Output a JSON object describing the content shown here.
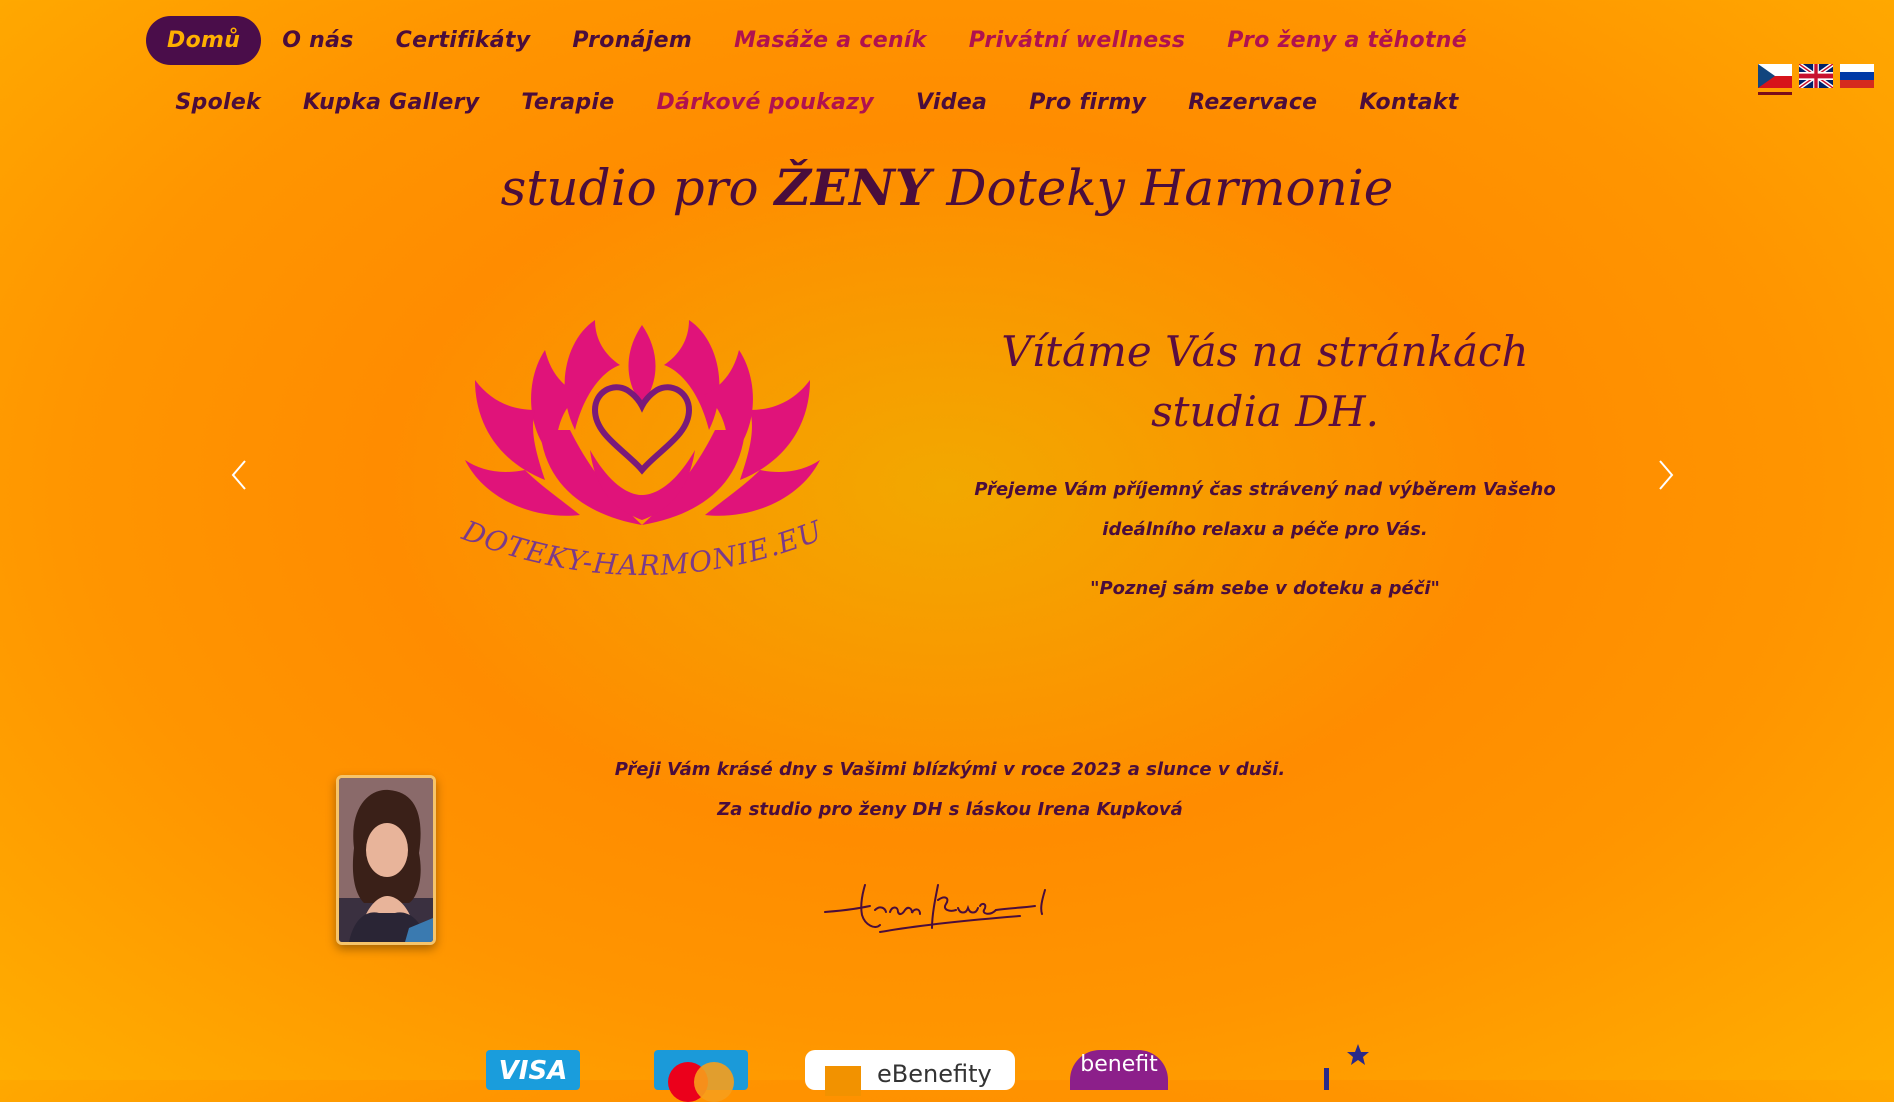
{
  "nav": {
    "row1": [
      {
        "label": "Domů",
        "active": true
      },
      {
        "label": "O nás"
      },
      {
        "label": "Certifikáty"
      },
      {
        "label": "Pronájem"
      },
      {
        "label": "Masáže a ceník",
        "highlight": true
      },
      {
        "label": "Privátní wellness",
        "highlight": true
      },
      {
        "label": "Pro ženy a těhotné",
        "highlight": true
      }
    ],
    "row2": [
      {
        "label": "Spolek"
      },
      {
        "label": "Kupka Gallery"
      },
      {
        "label": "Terapie"
      },
      {
        "label": "Dárkové poukazy",
        "highlight": true
      },
      {
        "label": "Videa"
      },
      {
        "label": "Pro firmy"
      },
      {
        "label": "Rezervace"
      },
      {
        "label": "Kontakt"
      }
    ]
  },
  "languages": [
    "cz-flag-icon",
    "gb-flag-icon",
    "ru-flag-icon"
  ],
  "title": {
    "part1": "studio pro ",
    "bold": "ŽENY",
    "part2": " Doteky Harmonie"
  },
  "logo": {
    "text": "DOTEKY-HARMONIE.EU"
  },
  "slide": {
    "welcome_line1": "Vítáme Vás na stránkách",
    "welcome_line2": "studia DH.",
    "wish_line1": "Přejeme Vám příjemný čas strávený nad výběrem Vašeho",
    "wish_line2": "ideálního relaxu a péče pro Vás.",
    "motto": "\"Poznej sám sebe v doteku a péči\""
  },
  "greeting": {
    "line1": "Přeji Vám krásé dny s Vašimi blízkými v roce 2023 a slunce v duši.",
    "line2": "Za studio pro ženy DH s láskou Irena Kupková"
  },
  "payments": {
    "visa": "VISA",
    "ebenefity": "eBenefity",
    "benefit": "benefit"
  },
  "colors": {
    "text": "#4a0d3c",
    "highlight": "#b0124f",
    "active_bg": "#4a0d4a",
    "logo_pink": "#e0137a",
    "logo_purple": "#7a1a7a"
  }
}
